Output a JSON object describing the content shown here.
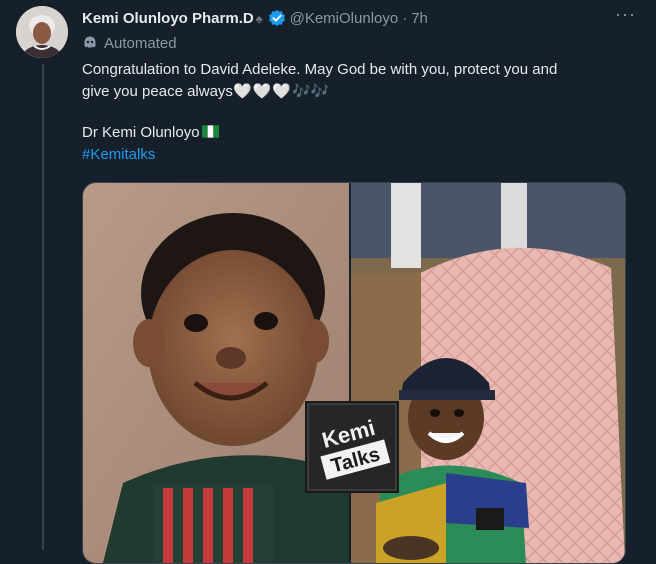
{
  "author": {
    "name": "Kemi Olunloyo Pharm.D",
    "name_suffix_icon": "♠",
    "verified_icon": "verified-badge-icon",
    "handle": "@KemiOlunloyo",
    "separator": "·",
    "time": "7h"
  },
  "label": {
    "icon": "bot-icon",
    "text": "Automated"
  },
  "tweet": {
    "line1": "Congratulation to David Adeleke. May God be with you, protect you and",
    "line2_text": "give you peace always",
    "line2_emoji": "🤍🤍🤍",
    "line2_music": "🎶🎶",
    "signature": "Dr Kemi Olunloyo",
    "hashtag": "#Kemitalks"
  },
  "more_menu": "···",
  "media": {
    "watermark_line1": "Kemi",
    "watermark_line2": "Talks"
  },
  "colors": {
    "background": "#15202b",
    "text": "#e7e9ea",
    "muted": "#8b98a5",
    "accent": "#1d9bf0",
    "border": "#38444d"
  }
}
